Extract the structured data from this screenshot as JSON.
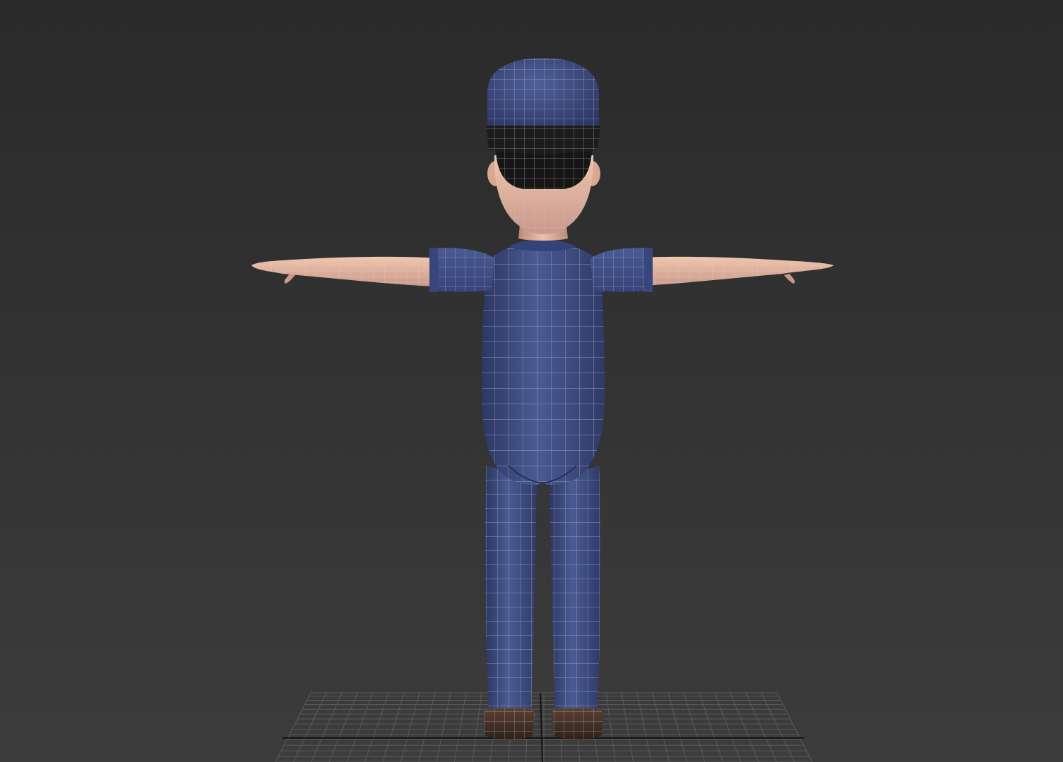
{
  "viewport": {
    "view": "back",
    "shading": "smooth-shaded-with-wireframe-edges",
    "background_color_top": "#2a2a2a",
    "background_color_bottom": "#3c3c3c",
    "home_grid_visible": true
  },
  "model": {
    "pose": "T-pose",
    "colors": {
      "clothing": "#3f4f85",
      "clothing_shadow": "#2b3763",
      "skin": "#e8b8a0",
      "skin_shadow": "#b98874",
      "hat_band": "#1c1c1c",
      "hair": "#161616",
      "shoes": "#4a3326",
      "wire": "#b8b8c0"
    }
  },
  "grid": {
    "line_color": "#5a5a5a",
    "axis_color": "#151515"
  }
}
